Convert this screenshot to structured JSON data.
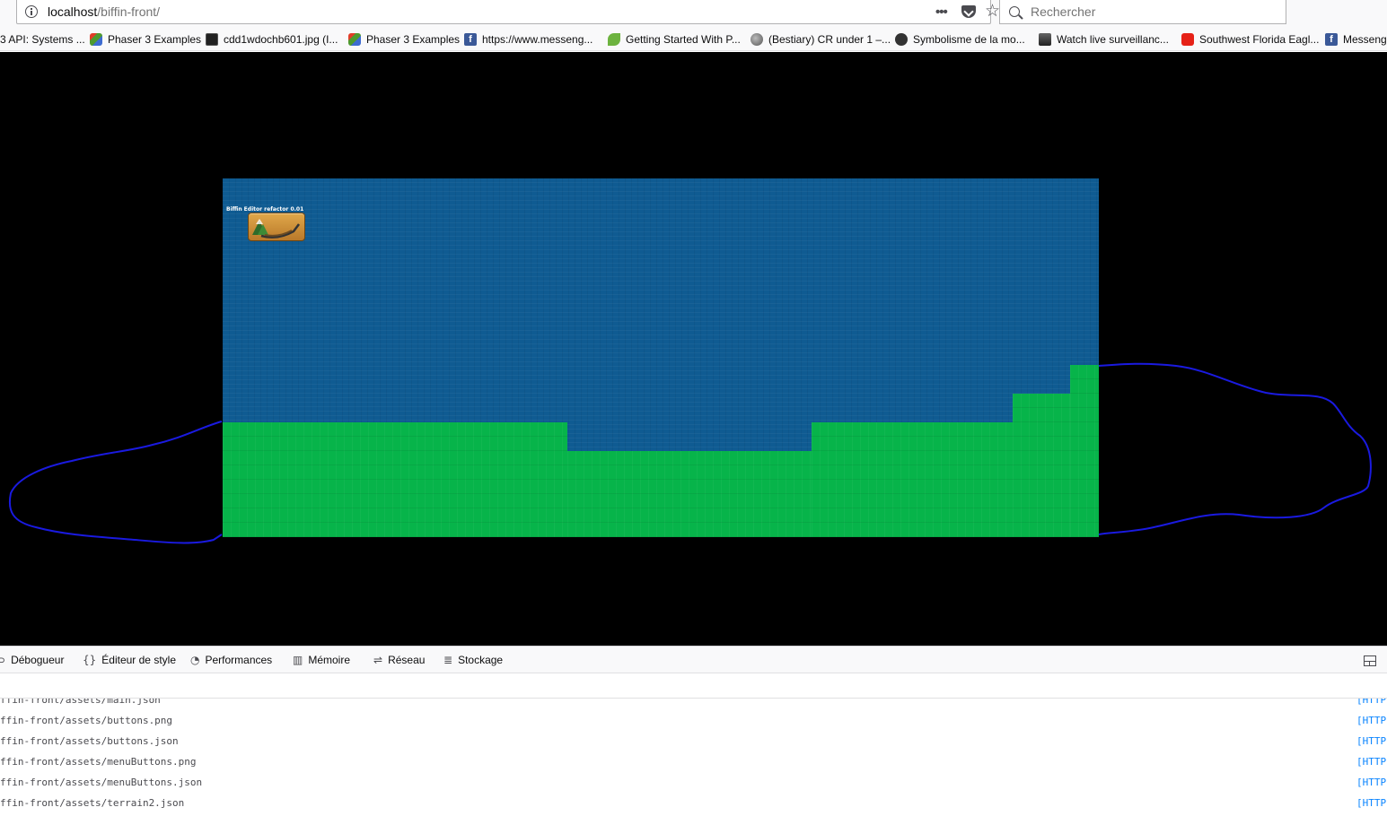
{
  "browser": {
    "url_host": "localhost",
    "url_path": "/biffin-front/",
    "page_actions_label": "•••",
    "star_glyph": "☆",
    "search_placeholder": "Rechercher"
  },
  "bookmarks": [
    {
      "label": "3 API: Systems ...",
      "icon": "none"
    },
    {
      "label": "Phaser 3 Examples",
      "icon": "phaser-icon"
    },
    {
      "label": "cdd1wdochb601.jpg (I...",
      "icon": "image-icon"
    },
    {
      "label": "Phaser 3 Examples",
      "icon": "phaser-icon"
    },
    {
      "label": "https://www.messeng...",
      "icon": "facebook-icon"
    },
    {
      "label": "Getting Started With P...",
      "icon": "leaf-icon"
    },
    {
      "label": "(Bestiary) CR under 1 –...",
      "icon": "globe-icon"
    },
    {
      "label": "Symbolisme de la mo...",
      "icon": "flame-icon"
    },
    {
      "label": "Watch live surveillanc...",
      "icon": "camera-icon"
    },
    {
      "label": "Southwest Florida Eagl...",
      "icon": "youtube-icon"
    },
    {
      "label": "Messenger",
      "icon": "facebook-icon"
    }
  ],
  "game": {
    "editor_title": "Biffin Editor refactor 0.01",
    "colors": {
      "water": "#0f5b92",
      "terrain": "#07b44a",
      "background": "#000000",
      "annotation": "#1a1ae0"
    }
  },
  "devtools": {
    "tabs": [
      {
        "label": "Débogueur",
        "icon": "debugger-icon"
      },
      {
        "label": "Éditeur de style",
        "icon": "style-editor-icon"
      },
      {
        "label": "Performances",
        "icon": "performance-icon"
      },
      {
        "label": "Mémoire",
        "icon": "memory-icon"
      },
      {
        "label": "Réseau",
        "icon": "network-icon"
      },
      {
        "label": "Stockage",
        "icon": "storage-icon"
      }
    ],
    "log": [
      {
        "url": "ffin-front/assets/main.json",
        "meta": "[HTTP"
      },
      {
        "url": "ffin-front/assets/buttons.png",
        "meta": "[HTTP"
      },
      {
        "url": "ffin-front/assets/buttons.json",
        "meta": "[HTTP"
      },
      {
        "url": "ffin-front/assets/menuButtons.png",
        "meta": "[HTTP"
      },
      {
        "url": "ffin-front/assets/menuButtons.json",
        "meta": "[HTTP"
      },
      {
        "url": "ffin-front/assets/terrain2.json",
        "meta": "[HTTP"
      }
    ]
  }
}
